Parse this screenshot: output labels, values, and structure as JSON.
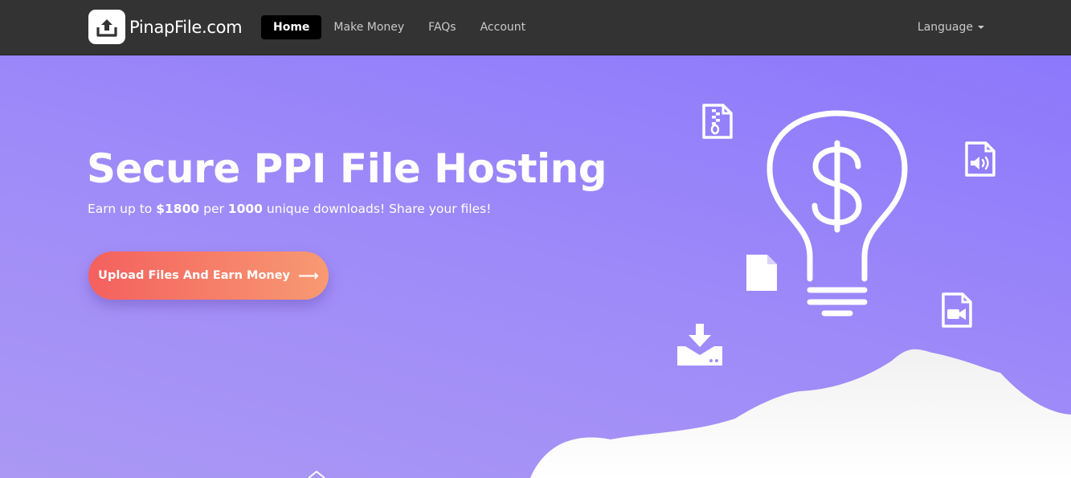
{
  "brand": {
    "name": "PinapFile.com",
    "logo_icon": "upload-box-icon"
  },
  "nav": {
    "items": [
      {
        "label": "Home",
        "active": true
      },
      {
        "label": "Make Money",
        "active": false
      },
      {
        "label": "FAQs",
        "active": false
      },
      {
        "label": "Account",
        "active": false
      }
    ],
    "language_label": "Language"
  },
  "hero": {
    "title": "Secure PPI File Hosting",
    "subtitle": {
      "prefix": "Earn up to ",
      "amount": "$1800",
      "middle": " per ",
      "count": "1000",
      "suffix": " unique downloads! Share your files!"
    },
    "cta_label": "Upload Files And Earn Money",
    "cta_arrow": "⟶"
  },
  "illustration": {
    "icons": [
      "zip-file-icon",
      "audio-file-icon",
      "document-file-icon",
      "video-file-icon",
      "download-drive-icon",
      "dollar-lightbulb-icon"
    ]
  },
  "colors": {
    "navbar": "#333333",
    "hero_top": "#8c78fb",
    "hero_bottom": "#aa98f4",
    "cta_start": "#f4605e",
    "cta_end": "#f79a72"
  }
}
